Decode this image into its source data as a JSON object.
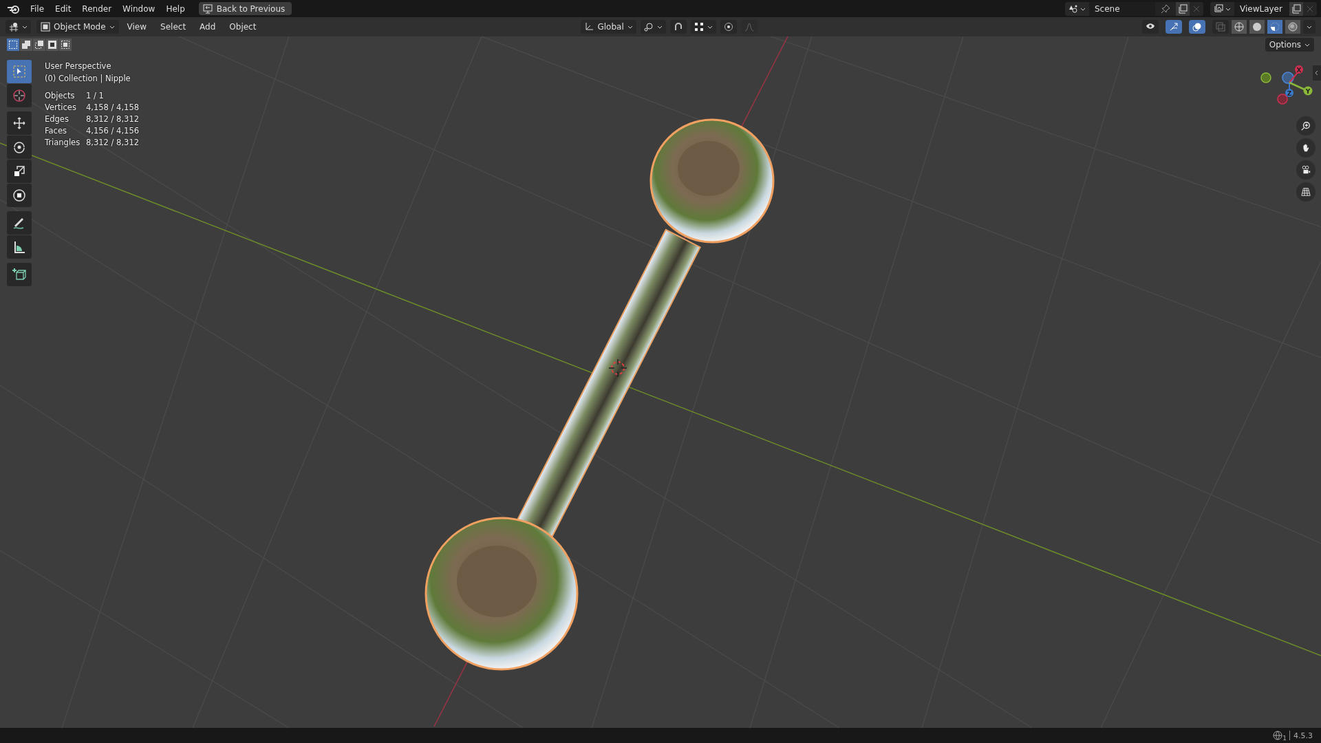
{
  "menu_bar": {
    "items": [
      "File",
      "Edit",
      "Render",
      "Window",
      "Help"
    ],
    "back_button": "Back to Previous"
  },
  "scene": {
    "name": "Scene"
  },
  "view_layer": {
    "name": "ViewLayer"
  },
  "header": {
    "mode": "Object Mode",
    "menus": [
      "View",
      "Select",
      "Add",
      "Object"
    ],
    "orientation": "Global",
    "snap_on": false,
    "proportional_on": false,
    "toggles": [
      {
        "kind": "visibility",
        "selected": false
      },
      {
        "kind": "gizmos",
        "selected": true
      },
      {
        "kind": "overlays",
        "selected": true
      },
      {
        "kind": "xray",
        "selected": false
      }
    ],
    "shading": [
      {
        "kind": "wireframe",
        "selected": false
      },
      {
        "kind": "solid",
        "selected": false
      },
      {
        "kind": "material",
        "selected": true
      },
      {
        "kind": "rendered",
        "selected": false
      }
    ]
  },
  "select_modes": [
    {
      "selected": true
    },
    {
      "selected": false
    },
    {
      "selected": false
    },
    {
      "selected": false
    },
    {
      "selected": false
    }
  ],
  "options_button": "Options",
  "toolbar": [
    {
      "kind": "select",
      "selected": true
    },
    {
      "kind": "cursor",
      "selected": false
    },
    {
      "kind": "move",
      "selected": false
    },
    {
      "kind": "rotate",
      "selected": false
    },
    {
      "kind": "scale",
      "selected": false
    },
    {
      "kind": "transform",
      "selected": false
    },
    {
      "kind": "annotate",
      "selected": false
    },
    {
      "kind": "measure",
      "selected": false
    },
    {
      "kind": "add_cube",
      "selected": false
    }
  ],
  "viewport_info": {
    "view": "User Perspective",
    "collection": "(0) Collection | Nipple",
    "stats": [
      {
        "label": "Objects",
        "value": "1 / 1"
      },
      {
        "label": "Vertices",
        "value": "4,158 / 4,158"
      },
      {
        "label": "Edges",
        "value": "8,312 / 8,312"
      },
      {
        "label": "Faces",
        "value": "4,156 / 4,156"
      },
      {
        "label": "Triangles",
        "value": "8,312 / 8,312"
      }
    ]
  },
  "gizmo": {
    "x": "X",
    "y": "Y",
    "z": "Z"
  },
  "status_bar": {
    "scene_count": "1",
    "version": "4.5.3"
  }
}
